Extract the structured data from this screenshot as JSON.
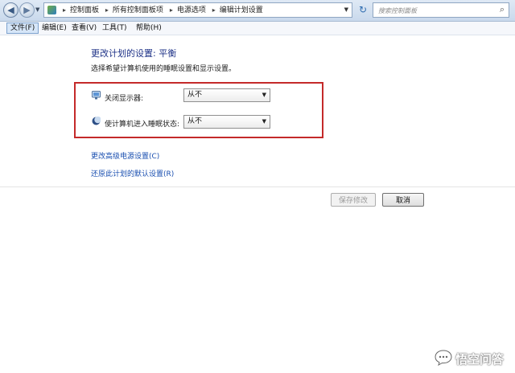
{
  "address_bar": {
    "breadcrumbs": [
      "控制面板",
      "所有控制面板项",
      "电源选项",
      "编辑计划设置"
    ],
    "search_placeholder": "搜索控制面板"
  },
  "menu": {
    "items": [
      "文件(F)",
      "编辑(E)",
      "查看(V)",
      "工具(T)",
      "帮助(H)"
    ],
    "active_index": 0
  },
  "page": {
    "title": "更改计划的设置: 平衡",
    "subtitle": "选择希望计算机使用的睡眠设置和显示设置。",
    "settings": [
      {
        "label": "关闭显示器:",
        "value": "从不",
        "icon": "monitor-icon"
      },
      {
        "label": "使计算机进入睡眠状态:",
        "value": "从不",
        "icon": "moon-icon"
      }
    ],
    "links": {
      "advanced": "更改高级电源设置(C)",
      "restore": "还原此计划的默认设置(R)"
    },
    "buttons": {
      "save": "保存修改",
      "cancel": "取消"
    }
  },
  "watermark": {
    "text": "悟空问答"
  },
  "colors": {
    "title": "#1e3287",
    "link": "#1a4fb0",
    "highlight_box": "#c42a2a"
  }
}
